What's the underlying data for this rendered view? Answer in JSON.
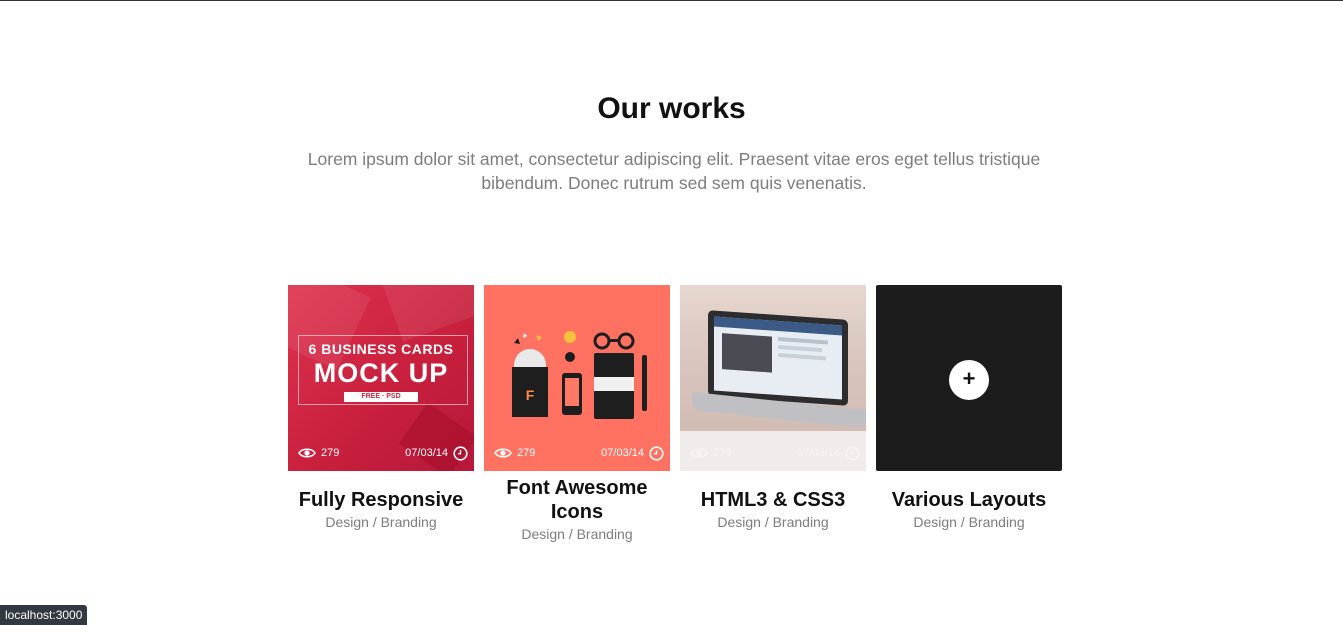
{
  "section": {
    "title": "Our works",
    "subtitle": "Lorem ipsum dolor sit amet, consectetur adipiscing elit. Praesent vitae eros eget tellus tristique bibendum. Donec rutrum sed sem quis venenatis."
  },
  "works": [
    {
      "title": "Fully Responsive",
      "category": "Design / Branding",
      "views": "279",
      "date": "07/03/14",
      "thumb_text_line1": "6 BUSINESS CARDS",
      "thumb_text_line2": "MOCK UP",
      "thumb_text_badge": "FREE · PSD"
    },
    {
      "title": "Font Awesome Icons",
      "category": "Design / Branding",
      "views": "279",
      "date": "07/03/14"
    },
    {
      "title": "HTML3 & CSS3",
      "category": "Design / Branding",
      "views": "279",
      "date": "07/03/14"
    },
    {
      "title": "Various Layouts",
      "category": "Design / Branding",
      "plus_label": "+"
    }
  ],
  "status_bar": {
    "url": "localhost:3000"
  },
  "colors": {
    "card1_bg": "#d2253f",
    "card2_bg": "#ff7262",
    "card4_bg": "#1c1c1c",
    "text_muted": "#7d7d7d"
  },
  "icons": [
    "eye-icon",
    "clock-icon",
    "plus-icon"
  ]
}
